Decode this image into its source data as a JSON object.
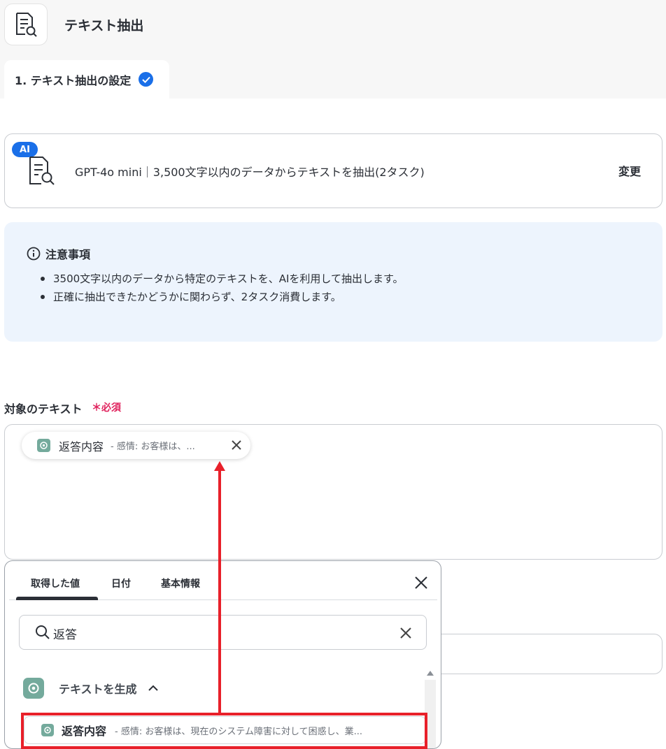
{
  "header": {
    "title": "テキスト抽出",
    "app_icon": "document-search-icon"
  },
  "steps": [
    {
      "label": "1. テキスト抽出の設定",
      "status": "completed"
    }
  ],
  "model_card": {
    "badge": "AI",
    "description": "GPT-4o mini｜3,500文字以内のデータからテキストを抽出(2タスク)",
    "change_label": "変更"
  },
  "notice": {
    "title": "注意事項",
    "items": [
      "3500文字以内のデータから特定のテキストを、AIを利用して抽出します。",
      "正確に抽出できたかどうかに関わらず、2タスク消費します。"
    ]
  },
  "target_field": {
    "label": "対象のテキスト",
    "required_label": "＊必須",
    "chip": {
      "title": "返答内容",
      "description": "- 感情: お客様は、..."
    }
  },
  "picker": {
    "tabs": [
      "取得した値",
      "日付",
      "基本情報"
    ],
    "active_tab": 0,
    "search": {
      "value": "返答",
      "placeholder": ""
    },
    "group": {
      "label": "テキストを生成",
      "expanded": true
    },
    "results": [
      {
        "title": "返答内容",
        "description": "- 感情: お客様は、現在のシステム障害に対して困惑し、業..."
      }
    ]
  },
  "colors": {
    "accent": "#1a6fe8",
    "required": "#e0245e",
    "annotation": "#e8202a",
    "notice_bg": "#edf4fd",
    "openai": "#74aa9c"
  }
}
